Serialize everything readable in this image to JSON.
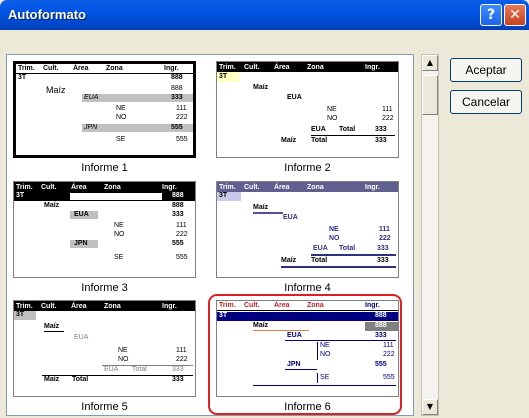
{
  "window": {
    "title": "Autoformato",
    "help_glyph": "?",
    "close_glyph": "✕"
  },
  "buttons": {
    "ok": "Aceptar",
    "cancel": "Cancelar"
  },
  "header_cols": [
    "Trim.",
    "Cult.",
    "Área",
    "Zona",
    "Ingr."
  ],
  "rows": {
    "t": "3T",
    "crop": "Maíz",
    "a1": "EUA",
    "a2": "JPN",
    "z1": "NE",
    "z2": "NO",
    "z3": "SE",
    "total": "Total",
    "v0": "888",
    "v1": "333",
    "v2": "111",
    "v3": "222",
    "v4": "555"
  },
  "reports": [
    "Informe 1",
    "Informe 2",
    "Informe 3",
    "Informe 4",
    "Informe 5",
    "Informe 6"
  ],
  "scroll_up": "▲",
  "scroll_down": "▼"
}
